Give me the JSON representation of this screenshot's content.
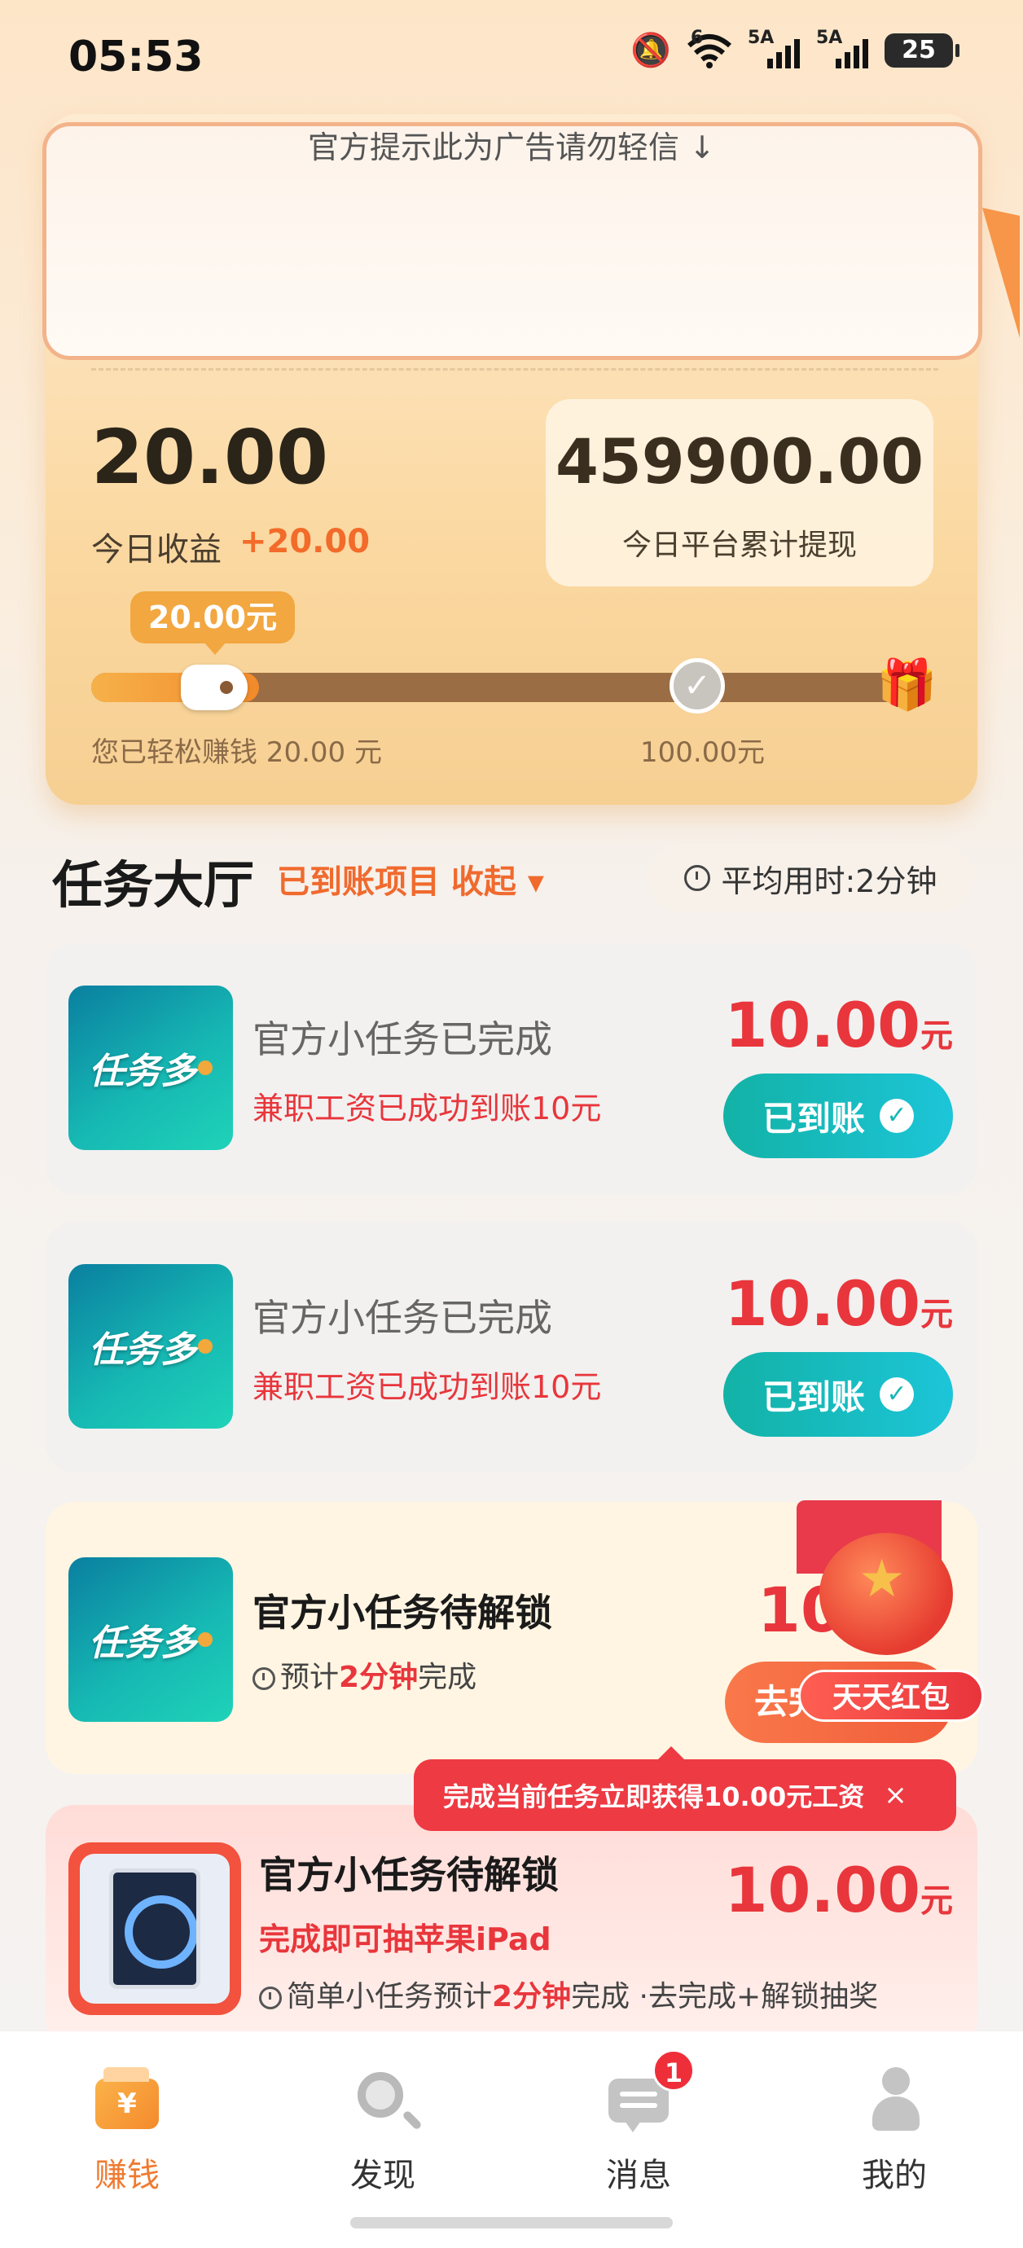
{
  "status_bar": {
    "time": "05:53",
    "mute_icon": "bell-off-icon",
    "wifi_icon": "wifi-icon",
    "wifi_badge": "6",
    "signal_1": "5A",
    "signal_2": "5A",
    "battery": "25"
  },
  "ad_notice": "官方提示此为广告请勿轻信 ↓",
  "earnings": {
    "today_value": "20.00",
    "today_label": "今日收益",
    "today_delta": "+20.00",
    "platform_value": "459900.00",
    "platform_label": "今日平台累计提现",
    "bubble": "20.00元",
    "progress_fraction": 0.2,
    "earned_label": "您已轻松赚钱 20.00 元",
    "goal_label": "100.00元"
  },
  "task_hall": {
    "title": "任务大厅",
    "sub": "已到账项目 收起 ▾",
    "avg_time": "平均用时:2分钟"
  },
  "tasks": [
    {
      "logo_text": "任务多",
      "title": "官方小任务已完成",
      "sub": "兼职工资已成功到账10元",
      "amount": "10.00",
      "unit": "元",
      "button": "已到账"
    },
    {
      "logo_text": "任务多",
      "title": "官方小任务已完成",
      "sub": "兼职工资已成功到账10元",
      "amount": "10.00",
      "unit": "元",
      "button": "已到账"
    },
    {
      "logo_text": "任务多",
      "title": "官方小任务待解锁",
      "sub_prefix": "预计",
      "sub_highlight": "2分钟",
      "sub_suffix": "完成",
      "amount": "10",
      "button": "去完"
    },
    {
      "title": "官方小任务待解锁",
      "sub": "完成即可抽苹果iPad",
      "detail_prefix": "简单小任务预计",
      "detail_highlight": "2分钟",
      "detail_suffix": "完成 ·去完成+解锁抽奖",
      "amount": "10.00",
      "unit": "元"
    }
  ],
  "red_packet": {
    "label": "天天红包"
  },
  "tip": {
    "text": "完成当前任务立即获得10.00元工资",
    "close": "×"
  },
  "nav": [
    {
      "label": "赚钱",
      "icon": "wallet-icon",
      "active": true
    },
    {
      "label": "发现",
      "icon": "discover-icon",
      "active": false
    },
    {
      "label": "消息",
      "icon": "message-icon",
      "badge": "1",
      "active": false
    },
    {
      "label": "我的",
      "icon": "profile-icon",
      "active": false
    }
  ],
  "colors": {
    "accent_orange": "#f07a30",
    "amount_red": "#e8363c",
    "done_teal": "#13b2a6"
  }
}
